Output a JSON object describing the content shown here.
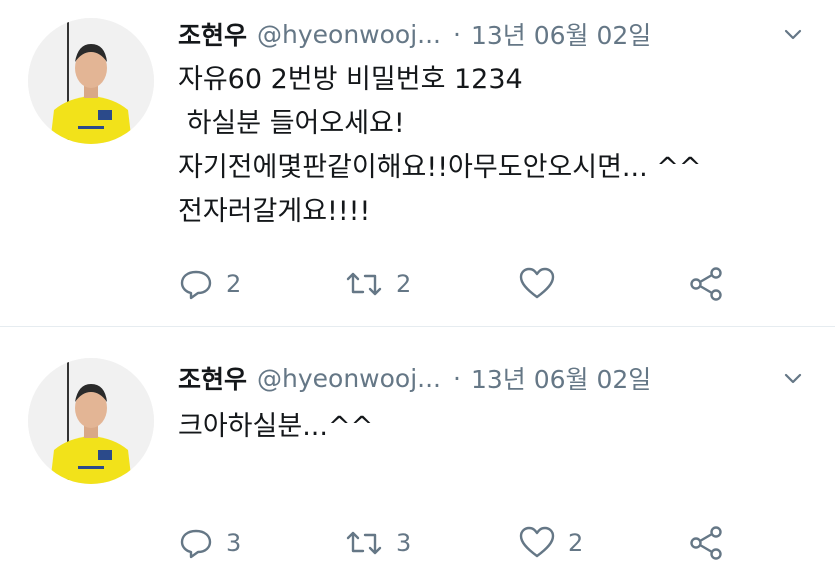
{
  "tweets": [
    {
      "author_name": "조현우",
      "handle": "@hyeonwooj...",
      "separator": "·",
      "date": "13년 06월 02일",
      "text": "자유60 2번방 비밀번호 1234\n 하실분 들어오세요!\n자기전에몇판같이해요!!아무도안오시면... ^^\n전자러갈게요!!!!",
      "reply_count": "2",
      "retweet_count": "2",
      "like_count": ""
    },
    {
      "author_name": "조현우",
      "handle": "@hyeonwooj...",
      "separator": "·",
      "date": "13년 06월 02일",
      "text": "크아하실분...^^",
      "reply_count": "3",
      "retweet_count": "3",
      "like_count": "2"
    }
  ],
  "icons": {
    "caret": "chevron-down-icon",
    "reply": "reply-icon",
    "retweet": "retweet-icon",
    "like": "heart-icon",
    "share": "share-icon"
  },
  "colors": {
    "text": "#14171a",
    "secondary": "#657786",
    "divider": "#e6ecf0",
    "jersey": "#f2e21a"
  }
}
